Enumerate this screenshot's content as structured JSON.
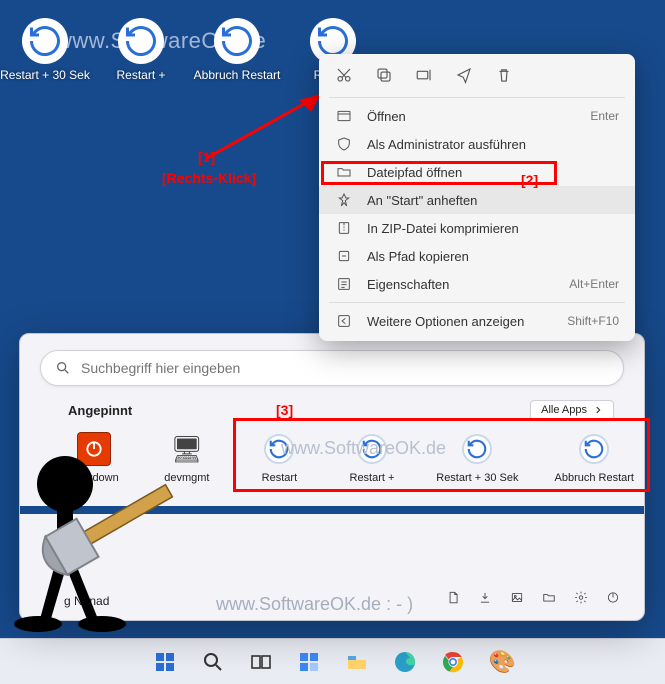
{
  "watermarks": {
    "top": "www.SoftwareOK.de",
    "mid": "www.SoftwareOK.de",
    "bottom": "www.SoftwareOK.de  : - )"
  },
  "desktop_icons": [
    {
      "label": "Restart + 30 Sek"
    },
    {
      "label": "Restart +"
    },
    {
      "label": "Abbruch Restart"
    },
    {
      "label": "Restart"
    }
  ],
  "annotations": {
    "step1": "[1]",
    "rightclick": "[Rechts-Klick]",
    "step2": "[2]",
    "step3": "[3]"
  },
  "context_menu": {
    "items": [
      {
        "icon": "open",
        "label": "Öffnen",
        "shortcut": "Enter"
      },
      {
        "icon": "admin",
        "label": "Als Administrator ausführen",
        "shortcut": ""
      },
      {
        "icon": "folder",
        "label": "Dateipfad öffnen",
        "shortcut": ""
      },
      {
        "icon": "pin",
        "label": "An \"Start\" anheften",
        "shortcut": "",
        "highlight": true
      },
      {
        "icon": "zip",
        "label": "In ZIP-Datei komprimieren",
        "shortcut": ""
      },
      {
        "icon": "copypath",
        "label": "Als Pfad kopieren",
        "shortcut": ""
      },
      {
        "icon": "props",
        "label": "Eigenschaften",
        "shortcut": "Alt+Enter"
      }
    ],
    "more": {
      "label": "Weitere Optionen anzeigen",
      "shortcut": "Shift+F10"
    }
  },
  "start": {
    "search_placeholder": "Suchbegriff hier eingeben",
    "pinned_title": "Angepinnt",
    "all_apps": "Alle Apps",
    "user": "g Nenad",
    "pinned": [
      {
        "type": "shutdown",
        "label": "Shutdown"
      },
      {
        "type": "dev",
        "label": "devmgmt"
      },
      {
        "type": "restart",
        "label": "Restart"
      },
      {
        "type": "restart",
        "label": "Restart +"
      },
      {
        "type": "restart",
        "label": "Restart + 30 Sek"
      },
      {
        "type": "restart",
        "label": "Abbruch Restart"
      }
    ]
  }
}
